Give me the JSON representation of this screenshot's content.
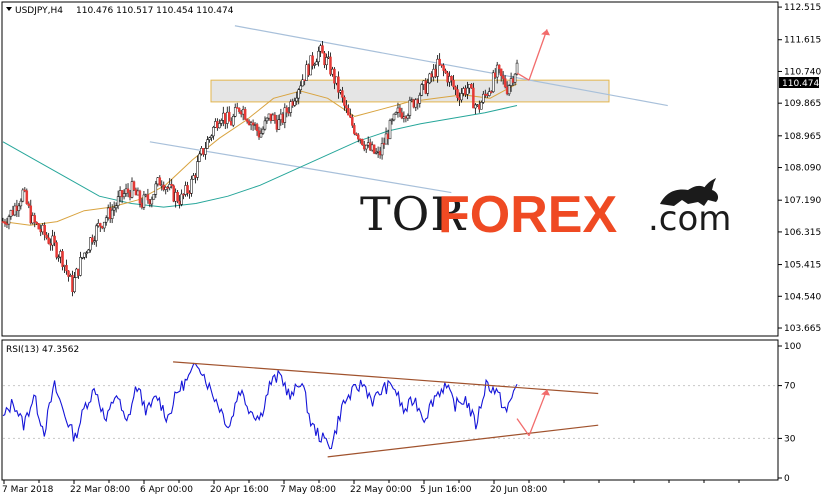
{
  "chart_data": [
    {
      "type": "candlestick",
      "symbol_label": "USDJPY,H4",
      "ohlc_label": "110.476 110.517 110.454 110.474",
      "current_price": "110.474",
      "ylim": [
        103.5,
        112.6
      ],
      "y_ticks": [
        "112.515",
        "111.615",
        "110.740",
        "109.865",
        "108.965",
        "108.090",
        "107.190",
        "106.315",
        "105.415",
        "104.540",
        "103.665"
      ],
      "x_ticks": [
        "7 Mar 2018",
        "22 Mar 08:00",
        "6 Apr 00:00",
        "20 Apr 16:00",
        "7 May 08:00",
        "22 May 00:00",
        "5 Jun 16:00",
        "20 Jun 08:00"
      ],
      "price_path": [
        106.6,
        106.9,
        107.4,
        106.6,
        106.3,
        106.0,
        105.6,
        104.8,
        105.6,
        106.2,
        106.6,
        106.9,
        107.3,
        107.5,
        107.1,
        107.3,
        107.8,
        107.4,
        107.2,
        107.6,
        108.4,
        109.0,
        109.6,
        109.3,
        109.8,
        109.4,
        109.0,
        109.5,
        109.3,
        109.8,
        110.4,
        110.9,
        111.3,
        110.9,
        110.2,
        109.4,
        109.0,
        108.6,
        108.4,
        109.1,
        109.6,
        109.7,
        110.1,
        110.4,
        110.9,
        110.6,
        110.1,
        110.3,
        109.7,
        110.2,
        110.7,
        110.3,
        110.9
      ],
      "ma_slow": [
        108.8,
        108.3,
        107.8,
        107.3,
        107.1,
        107.0,
        107.1,
        107.3,
        107.6,
        108.0,
        108.4,
        108.8,
        109.1,
        109.3,
        109.45,
        109.6,
        109.8
      ],
      "ma_fast": [
        106.6,
        106.5,
        106.6,
        106.9,
        107.0,
        107.2,
        107.6,
        108.3,
        108.9,
        109.4,
        110.0,
        110.2,
        110.0,
        109.5,
        109.7,
        109.9,
        110.0,
        110.1,
        110.0,
        110.4
      ],
      "channel_upper": [
        [
          0.3,
          112.0
        ],
        [
          0.86,
          109.8
        ]
      ],
      "channel_lower": [
        [
          0.19,
          108.8
        ],
        [
          0.58,
          107.4
        ]
      ],
      "resistance_zone": [
        109.9,
        110.5
      ],
      "forecast_arrow_peak": 111.9
    },
    {
      "type": "line",
      "label": "RSI(13) 47.3562",
      "ylim": [
        0,
        100
      ],
      "y_ticks": [
        "100",
        "70",
        "30",
        "0"
      ],
      "levels": [
        70,
        30
      ],
      "values": [
        45,
        58,
        40,
        62,
        35,
        70,
        48,
        30,
        55,
        68,
        42,
        65,
        40,
        70,
        50,
        62,
        45,
        66,
        75,
        88,
        70,
        55,
        38,
        68,
        52,
        45,
        72,
        78,
        60,
        75,
        40,
        30,
        25,
        55,
        65,
        72,
        58,
        68,
        70,
        50,
        60,
        45,
        62,
        70,
        55,
        60,
        40,
        72,
        65,
        50,
        72
      ],
      "trend_upper": [
        [
          0.22,
          88
        ],
        [
          0.77,
          64
        ]
      ],
      "trend_lower": [
        [
          0.42,
          16
        ],
        [
          0.77,
          40
        ]
      ],
      "forecast_arrow_peak": 67
    }
  ],
  "watermark": {
    "part1": "TOR",
    "part2": "FOREX",
    "part3": ".com"
  },
  "colors": {
    "candle": "#e53935",
    "ma_slow": "#26a69a",
    "ma_fast": "#d9a441",
    "channel": "#a8c0da",
    "zone_fill": "#e0e0e0",
    "zone_stroke": "#e3b64e",
    "rsi": "#1515d8",
    "rsi_trend": "#a0522d",
    "arrow": "#f26c6c",
    "forex": "#ef4a23"
  }
}
